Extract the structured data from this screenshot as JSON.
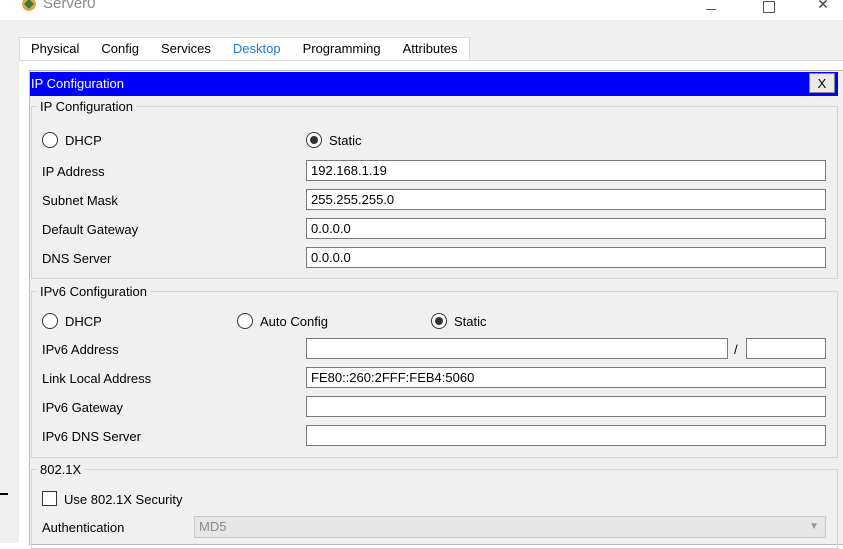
{
  "window": {
    "title": "Server0",
    "controls": {
      "close": "✕"
    }
  },
  "tabs": [
    {
      "label": "Physical",
      "active": false
    },
    {
      "label": "Config",
      "active": false
    },
    {
      "label": "Services",
      "active": false
    },
    {
      "label": "Desktop",
      "active": true
    },
    {
      "label": "Programming",
      "active": false
    },
    {
      "label": "Attributes",
      "active": false
    }
  ],
  "ip_window": {
    "title": "IP Configuration",
    "close_label": "X"
  },
  "ipv4": {
    "legend": "IP Configuration",
    "dhcp_label": "DHCP",
    "static_label": "Static",
    "selected": "Static",
    "ip_address_label": "IP Address",
    "ip_address_value": "192.168.1.19",
    "subnet_mask_label": "Subnet Mask",
    "subnet_mask_value": "255.255.255.0",
    "gateway_label": "Default Gateway",
    "gateway_value": "0.0.0.0",
    "dns_label": "DNS Server",
    "dns_value": "0.0.0.0"
  },
  "ipv6": {
    "legend": "IPv6 Configuration",
    "dhcp_label": "DHCP",
    "auto_label": "Auto Config",
    "static_label": "Static",
    "selected": "Static",
    "address_label": "IPv6 Address",
    "address_value": "",
    "prefix_separator": "/",
    "prefix_value": "",
    "link_local_label": "Link Local Address",
    "link_local_value": "FE80::260:2FFF:FEB4:5060",
    "gateway_label": "IPv6 Gateway",
    "gateway_value": "",
    "dns_label": "IPv6 DNS Server",
    "dns_value": ""
  },
  "dot1x": {
    "legend": "802.1X",
    "use_label": "Use 802.1X Security",
    "use_checked": false,
    "auth_label": "Authentication",
    "auth_value": "MD5"
  },
  "colors": {
    "header_blue": "#0000ff",
    "active_tab": "#1b7bd0"
  }
}
